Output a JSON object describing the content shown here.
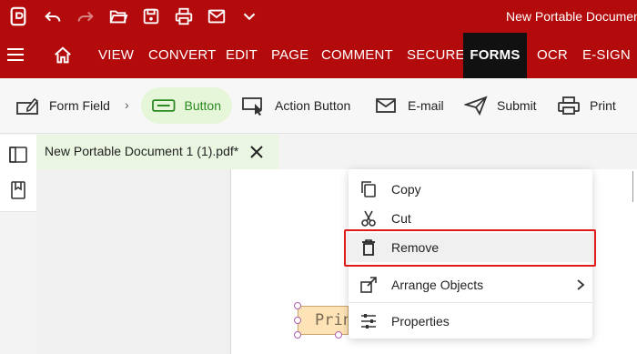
{
  "titlebar": {
    "title": "New Portable Documen",
    "icons": [
      "app-logo-icon",
      "undo-icon",
      "redo-icon",
      "open-folder-icon",
      "save-icon",
      "print-icon",
      "email-icon",
      "chevron-down-icon"
    ]
  },
  "menubar": {
    "items": [
      {
        "label": "VIEW"
      },
      {
        "label": "CONVERT"
      },
      {
        "label": "EDIT"
      },
      {
        "label": "PAGE"
      },
      {
        "label": "COMMENT"
      },
      {
        "label": "SECURE"
      },
      {
        "label": "FORMS",
        "active": true
      },
      {
        "label": "OCR"
      },
      {
        "label": "E-SIGN"
      }
    ]
  },
  "ribbon": {
    "form_field": "Form Field",
    "button": "Button",
    "action_button": "Action Button",
    "email": "E-mail",
    "submit": "Submit",
    "print": "Print"
  },
  "document": {
    "tab_name": "New Portable Document 1 (1).pdf*",
    "field_text": "Prin"
  },
  "context_menu": {
    "copy": "Copy",
    "cut": "Cut",
    "remove": "Remove",
    "arrange": "Arrange Objects",
    "properties": "Properties"
  },
  "colors": {
    "brand": "#b30b0b",
    "active_tab": "#111111",
    "selected_ribbon": "#e6f6d9",
    "highlight": "#e01b1b"
  }
}
